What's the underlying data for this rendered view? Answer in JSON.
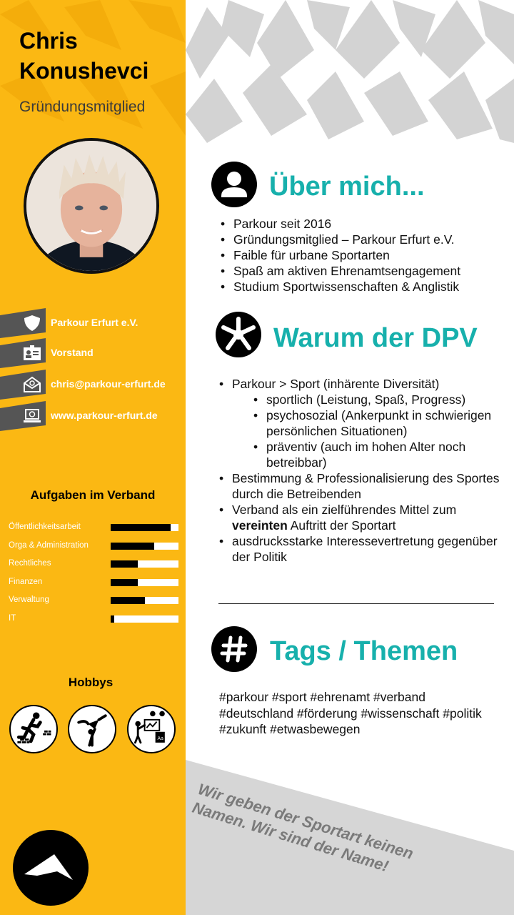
{
  "profile": {
    "first_name": "Chris",
    "last_name": "Konushevci",
    "role": "Gründungsmitglied"
  },
  "contact": [
    {
      "icon": "shield-icon",
      "text": "Parkour Erfurt e.V."
    },
    {
      "icon": "id-card-icon",
      "text": "Vorstand"
    },
    {
      "icon": "email-icon",
      "text": "chris@parkour-erfurt.de"
    },
    {
      "icon": "laptop-web-icon",
      "text": "www.parkour-erfurt.de"
    }
  ],
  "tasks": {
    "title": "Aufgaben im Verband",
    "items": [
      {
        "label": "Öffentlichkeitsarbeit",
        "level": 0.88
      },
      {
        "label": "Orga & Administration",
        "level": 0.64
      },
      {
        "label": "Rechtliches",
        "level": 0.4
      },
      {
        "label": "Finanzen",
        "level": 0.4
      },
      {
        "label": "Verwaltung",
        "level": 0.5
      },
      {
        "label": "IT",
        "level": 0.05
      }
    ]
  },
  "hobbies": {
    "title": "Hobbys",
    "items": [
      "parkour-runner-icon",
      "handstand-icon",
      "teaching-icon"
    ]
  },
  "about": {
    "title": "Über mich...",
    "icon": "user-icon",
    "items": [
      "Parkour seit 2016",
      "Gründungsmitglied – Parkour Erfurt e.V.",
      "Faible für urbane Sportarten",
      "Spaß am aktiven Ehrenamtsengagement",
      "Studium Sportwissenschaften & Anglistik"
    ]
  },
  "why": {
    "title": "Warum der DPV",
    "icon": "hands-together-icon",
    "item1": "Parkour > Sport (inhärente Diversität)",
    "sub": [
      "sportlich (Leistung, Spaß, Progress)",
      "psychosozial (Ankerpunkt in schwierigen persönlichen Situationen)",
      "präventiv (auch im hohen Alter noch betreibbar)"
    ],
    "item2": "Bestimmung & Professionalisierung des Sportes durch die Betreibenden",
    "item3_pre": "Verband als ein zielführendes Mittel zum ",
    "item3_bold": "vereinten",
    "item3_post": " Auftritt der Sportart",
    "item4": "ausdrucksstarke Interessevertretung gegenüber der Politik"
  },
  "tags": {
    "title": "Tags / Themen",
    "icon": "hashtag-icon",
    "text": "#parkour #sport #ehrenamt #verband #deutschland #förderung #wissenschaft #politik #zukunft #etwasbewegen"
  },
  "slogan": "Wir geben der Sportart keinen Namen. Wir sind der Name!",
  "colors": {
    "accent_yellow": "#fbb813",
    "heading_teal": "#17b0ac",
    "band_gray": "#d6d6d6"
  }
}
